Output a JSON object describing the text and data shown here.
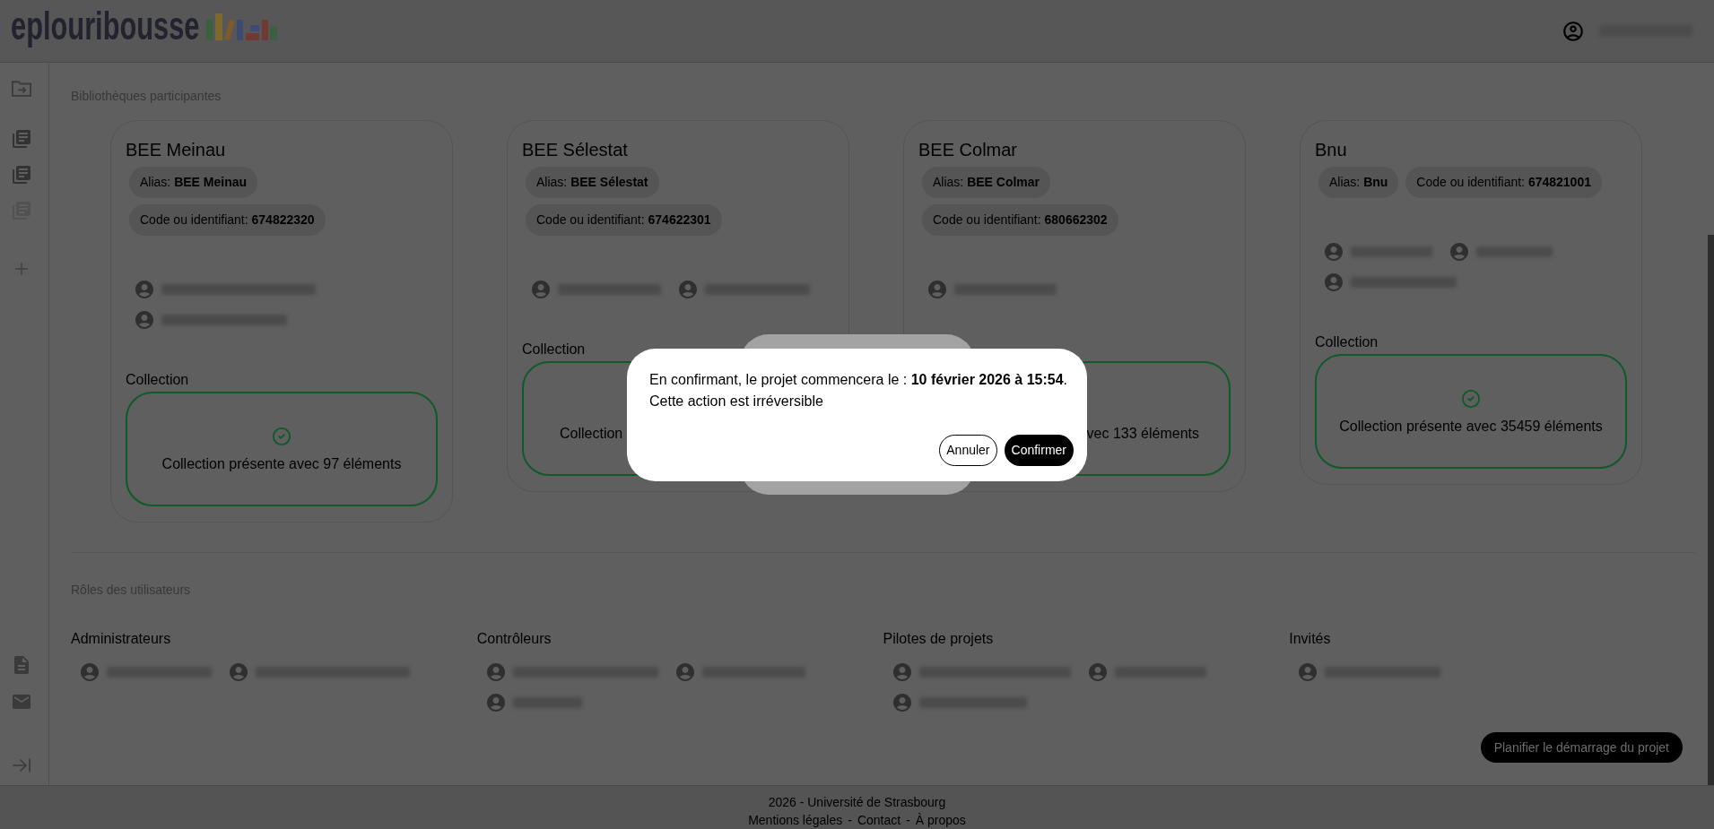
{
  "header": {
    "logo": "eplouribousse",
    "user": {
      "kind": "redacted"
    }
  },
  "sidebar": {
    "libraries": [
      {
        "disabled": false
      },
      {
        "disabled": false
      },
      {
        "disabled": true
      }
    ]
  },
  "libraries_section": {
    "title": "Bibliothèques participantes",
    "cards": [
      {
        "name": "BEE Meinau",
        "tags": [
          "Alias: **BEE Meinau**",
          "Code ou identifiant: **674822320**"
        ],
        "members": [
          {
            "kind": "redacted"
          },
          {
            "kind": "redacted"
          }
        ],
        "collection": {
          "label": "Collection",
          "kind": "full",
          "text": "Collection présente avec 97 éléments"
        }
      },
      {
        "name": "BEE Sélestat",
        "tags": [
          "Alias: **BEE Sélestat**",
          "Code ou identifiant: **674622301**"
        ],
        "members": [
          {
            "kind": "redacted"
          },
          {
            "kind": "redacted"
          }
        ],
        "collection": {
          "label": "Collection",
          "kind": "cut-right",
          "text": "Collection"
        }
      },
      {
        "name": "BEE Colmar",
        "tags": [
          "Alias: **BEE Colmar**",
          "Code ou identifiant: **680662302**"
        ],
        "members": [
          {
            "kind": "redacted"
          }
        ],
        "collection": {
          "kind": "cut-left",
          "text": "vec 133 éléments"
        }
      },
      {
        "name": "Bnu",
        "tags": [
          "Alias: **Bnu**",
          "Code ou identifiant: **674821001**"
        ],
        "members": [
          {
            "kind": "redacted"
          },
          {
            "kind": "redacted"
          },
          {
            "kind": "redacted"
          }
        ],
        "collection": {
          "label": "Collection",
          "kind": "full",
          "text": "Collection présente avec 35459 éléments"
        }
      }
    ]
  },
  "roles_section": {
    "title": "Rôles des utilisateurs",
    "roles": [
      {
        "name": "Administrateurs",
        "members": [
          {
            "kind": "redacted"
          },
          {
            "kind": "redacted"
          }
        ]
      },
      {
        "name": "Contrôleurs",
        "members": [
          {
            "kind": "redacted"
          },
          {
            "kind": "redacted"
          },
          {
            "kind": "redacted"
          }
        ]
      },
      {
        "name": "Pilotes de projets",
        "members": [
          {
            "kind": "redacted"
          },
          {
            "kind": "redacted"
          },
          {
            "kind": "redacted"
          }
        ]
      },
      {
        "name": "Invités",
        "members": [
          {
            "kind": "redacted"
          }
        ]
      }
    ]
  },
  "plan_button": {
    "label": "Planifier le démarrage du projet"
  },
  "footer": {
    "line": "2026 - Université de Strasbourg",
    "links": [
      "Mentions légales",
      "Contact",
      "À propos"
    ],
    "separators": [
      "-",
      "-"
    ]
  },
  "dialog": {
    "message": "En confirmant, le projet commencera le : **10 février 2026 à 15:54**.",
    "warning": "Cette action est irréversible",
    "buttons": [
      {
        "kind": "secondary",
        "label": "Annuler"
      },
      {
        "kind": "primary",
        "label": "Confirmer"
      }
    ]
  }
}
